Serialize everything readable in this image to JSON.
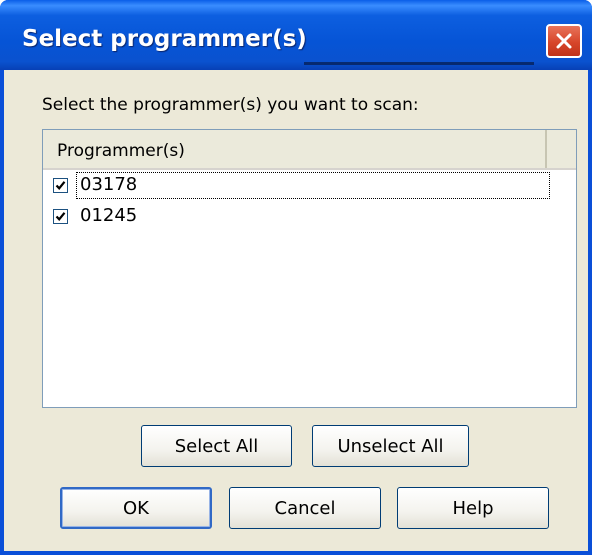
{
  "window": {
    "title": "Select programmer(s)",
    "close_icon": "close-icon"
  },
  "prompt": "Select the programmer(s) you want to scan:",
  "list": {
    "column_header": "Programmer(s)",
    "items": [
      {
        "label": "03178",
        "checked": true,
        "focused": true
      },
      {
        "label": "01245",
        "checked": true,
        "focused": false
      }
    ]
  },
  "buttons": {
    "select_all": "Select All",
    "unselect_all": "Unselect All",
    "ok": "OK",
    "cancel": "Cancel",
    "help": "Help"
  },
  "colors": {
    "titlebar": "#0a5ee8",
    "dialog_bg": "#ece9d8",
    "close_button": "#d7462a"
  }
}
